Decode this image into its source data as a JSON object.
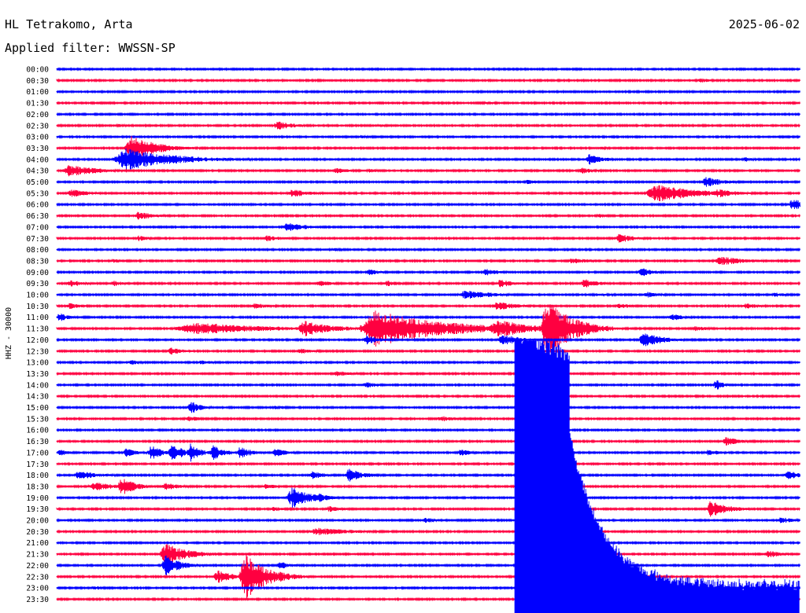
{
  "header": {
    "station": "HL Tetrakomo, Arta",
    "date": "2025-06-02",
    "filter": "Applied filter: WWSSN-SP"
  },
  "chart_data": {
    "type": "helicorder",
    "ylabel": "HHZ - 30000",
    "colors": [
      "#0000ff",
      "#ff0040"
    ],
    "rows": [
      "00:00",
      "00:30",
      "01:00",
      "01:30",
      "02:00",
      "02:30",
      "03:00",
      "03:30",
      "04:00",
      "04:30",
      "05:00",
      "05:30",
      "06:00",
      "06:30",
      "07:00",
      "07:30",
      "08:00",
      "08:30",
      "09:00",
      "09:30",
      "10:00",
      "10:30",
      "11:00",
      "11:30",
      "12:00",
      "12:30",
      "13:00",
      "13:30",
      "14:00",
      "14:30",
      "15:00",
      "15:30",
      "16:00",
      "16:30",
      "17:00",
      "17:30",
      "18:00",
      "18:30",
      "19:00",
      "19:30",
      "20:00",
      "20:30",
      "21:00",
      "21:30",
      "22:00",
      "22:30",
      "23:00",
      "23:30"
    ],
    "events": [
      {
        "row": 0,
        "minute": 7.7,
        "amp": 1.5,
        "dur": 0.3
      },
      {
        "row": 1,
        "minute": 26.0,
        "amp": 3,
        "dur": 0.5
      },
      {
        "row": 3,
        "minute": 17.3,
        "amp": 2,
        "dur": 0.4
      },
      {
        "row": 5,
        "minute": 2.5,
        "amp": 2,
        "dur": 0.5
      },
      {
        "row": 5,
        "minute": 8.9,
        "amp": 6,
        "dur": 0.7
      },
      {
        "row": 5,
        "minute": 13.0,
        "amp": 2,
        "dur": 0.4
      },
      {
        "row": 6,
        "minute": 12.3,
        "amp": 2,
        "dur": 0.4
      },
      {
        "row": 7,
        "minute": 3.0,
        "amp": 16,
        "dur": 1.0
      },
      {
        "row": 7,
        "minute": 3.8,
        "amp": 8,
        "dur": 1.0
      },
      {
        "row": 7,
        "minute": 22.0,
        "amp": 2,
        "dur": 0.4
      },
      {
        "row": 8,
        "minute": 2.8,
        "amp": 14,
        "dur": 2.0
      },
      {
        "row": 8,
        "minute": 21.5,
        "amp": 7,
        "dur": 0.6
      },
      {
        "row": 8,
        "minute": 27.8,
        "amp": 3,
        "dur": 0.5
      },
      {
        "row": 9,
        "minute": 0.5,
        "amp": 8,
        "dur": 1.2
      },
      {
        "row": 9,
        "minute": 11.3,
        "amp": 4,
        "dur": 0.6
      },
      {
        "row": 9,
        "minute": 12.6,
        "amp": 3,
        "dur": 0.5
      },
      {
        "row": 9,
        "minute": 21.2,
        "amp": 4,
        "dur": 0.5
      },
      {
        "row": 10,
        "minute": 19.0,
        "amp": 3,
        "dur": 0.5
      },
      {
        "row": 10,
        "minute": 26.2,
        "amp": 7,
        "dur": 0.7
      },
      {
        "row": 11,
        "minute": 0.6,
        "amp": 5,
        "dur": 0.8
      },
      {
        "row": 11,
        "minute": 9.5,
        "amp": 6,
        "dur": 0.7
      },
      {
        "row": 11,
        "minute": 24.2,
        "amp": 12,
        "dur": 1.6
      },
      {
        "row": 11,
        "minute": 26.7,
        "amp": 6,
        "dur": 0.8
      },
      {
        "row": 12,
        "minute": 29.7,
        "amp": 8,
        "dur": 0.6
      },
      {
        "row": 13,
        "minute": 3.3,
        "amp": 6,
        "dur": 0.6
      },
      {
        "row": 13,
        "minute": 21.9,
        "amp": 3,
        "dur": 0.4
      },
      {
        "row": 14,
        "minute": 9.3,
        "amp": 7,
        "dur": 0.7
      },
      {
        "row": 15,
        "minute": 3.3,
        "amp": 4,
        "dur": 0.5
      },
      {
        "row": 15,
        "minute": 8.5,
        "amp": 4,
        "dur": 0.7
      },
      {
        "row": 15,
        "minute": 22.7,
        "amp": 6,
        "dur": 0.7
      },
      {
        "row": 16,
        "minute": 11.2,
        "amp": 3,
        "dur": 0.4
      },
      {
        "row": 17,
        "minute": 2.3,
        "amp": 3,
        "dur": 0.5
      },
      {
        "row": 17,
        "minute": 20.8,
        "amp": 4,
        "dur": 0.8
      },
      {
        "row": 17,
        "minute": 26.8,
        "amp": 6,
        "dur": 1.0
      },
      {
        "row": 18,
        "minute": 12.6,
        "amp": 4,
        "dur": 0.5
      },
      {
        "row": 18,
        "minute": 17.3,
        "amp": 5,
        "dur": 0.6
      },
      {
        "row": 18,
        "minute": 23.6,
        "amp": 6,
        "dur": 0.5
      },
      {
        "row": 19,
        "minute": 0.5,
        "amp": 5,
        "dur": 0.6
      },
      {
        "row": 19,
        "minute": 2.3,
        "amp": 4,
        "dur": 0.5
      },
      {
        "row": 19,
        "minute": 10.6,
        "amp": 4,
        "dur": 0.6
      },
      {
        "row": 19,
        "minute": 13.3,
        "amp": 4,
        "dur": 0.6
      },
      {
        "row": 19,
        "minute": 17.9,
        "amp": 5,
        "dur": 0.7
      },
      {
        "row": 19,
        "minute": 21.3,
        "amp": 6,
        "dur": 0.6
      },
      {
        "row": 20,
        "minute": 16.5,
        "amp": 6,
        "dur": 1.2
      },
      {
        "row": 20,
        "minute": 21.8,
        "amp": 3,
        "dur": 0.6
      },
      {
        "row": 20,
        "minute": 23.8,
        "amp": 4,
        "dur": 0.6
      },
      {
        "row": 20,
        "minute": 29.0,
        "amp": 3,
        "dur": 0.5
      },
      {
        "row": 21,
        "minute": 0.5,
        "amp": 4,
        "dur": 0.6
      },
      {
        "row": 21,
        "minute": 8.0,
        "amp": 4,
        "dur": 0.6
      },
      {
        "row": 21,
        "minute": 17.8,
        "amp": 6,
        "dur": 0.8
      },
      {
        "row": 21,
        "minute": 22.7,
        "amp": 4,
        "dur": 0.5
      },
      {
        "row": 21,
        "minute": 27.8,
        "amp": 4,
        "dur": 0.6
      },
      {
        "row": 22,
        "minute": 0.1,
        "amp": 6,
        "dur": 0.4
      },
      {
        "row": 22,
        "minute": 24.8,
        "amp": 5,
        "dur": 0.6
      },
      {
        "row": 23,
        "minute": 5.5,
        "amp": 8,
        "dur": 3.0
      },
      {
        "row": 23,
        "minute": 10.0,
        "amp": 10,
        "dur": 1.2
      },
      {
        "row": 23,
        "minute": 12.9,
        "amp": 24,
        "dur": 2.6
      },
      {
        "row": 23,
        "minute": 17.8,
        "amp": 12,
        "dur": 1.4
      },
      {
        "row": 23,
        "minute": 19.8,
        "amp": 40,
        "dur": 1.0
      },
      {
        "row": 23,
        "minute": 25.8,
        "amp": 4,
        "dur": 0.5
      },
      {
        "row": 24,
        "minute": 12.5,
        "amp": 6,
        "dur": 0.6
      },
      {
        "row": 24,
        "minute": 18.0,
        "amp": 7,
        "dur": 0.9
      },
      {
        "row": 24,
        "minute": 23.7,
        "amp": 10,
        "dur": 0.8
      },
      {
        "row": 25,
        "minute": 4.6,
        "amp": 5,
        "dur": 0.6
      },
      {
        "row": 25,
        "minute": 9.8,
        "amp": 4,
        "dur": 0.6
      },
      {
        "row": 26,
        "minute": 3.0,
        "amp": 3,
        "dur": 0.6
      },
      {
        "row": 26,
        "minute": 5.8,
        "amp": 3,
        "dur": 0.6
      },
      {
        "row": 27,
        "minute": 11.3,
        "amp": 4,
        "dur": 0.6
      },
      {
        "row": 28,
        "minute": 12.5,
        "amp": 4,
        "dur": 0.5
      },
      {
        "row": 28,
        "minute": 26.6,
        "amp": 8,
        "dur": 0.3
      },
      {
        "row": 30,
        "minute": 5.4,
        "amp": 9,
        "dur": 0.4
      },
      {
        "row": 30,
        "minute": 8.8,
        "amp": 3,
        "dur": 0.5
      },
      {
        "row": 31,
        "minute": 5.3,
        "amp": 4,
        "dur": 0.5
      },
      {
        "row": 31,
        "minute": 15.5,
        "amp": 4,
        "dur": 0.6
      },
      {
        "row": 33,
        "minute": 27.0,
        "amp": 6,
        "dur": 0.6
      },
      {
        "row": 34,
        "minute": 0.1,
        "amp": 5,
        "dur": 0.4
      },
      {
        "row": 34,
        "minute": 2.8,
        "amp": 6,
        "dur": 0.5
      },
      {
        "row": 34,
        "minute": 3.8,
        "amp": 10,
        "dur": 0.5
      },
      {
        "row": 34,
        "minute": 4.6,
        "amp": 14,
        "dur": 0.5
      },
      {
        "row": 34,
        "minute": 5.4,
        "amp": 12,
        "dur": 0.4
      },
      {
        "row": 34,
        "minute": 6.3,
        "amp": 10,
        "dur": 0.5
      },
      {
        "row": 34,
        "minute": 7.4,
        "amp": 8,
        "dur": 0.5
      },
      {
        "row": 34,
        "minute": 8.8,
        "amp": 6,
        "dur": 0.5
      },
      {
        "row": 34,
        "minute": 16.3,
        "amp": 4,
        "dur": 0.8
      },
      {
        "row": 34,
        "minute": 19.6,
        "amp": 4,
        "dur": 0.6
      },
      {
        "row": 34,
        "minute": 26.3,
        "amp": 4,
        "dur": 0.6
      },
      {
        "row": 36,
        "minute": 0.9,
        "amp": 6,
        "dur": 0.8
      },
      {
        "row": 36,
        "minute": 10.3,
        "amp": 6,
        "dur": 0.5
      },
      {
        "row": 36,
        "minute": 11.8,
        "amp": 9,
        "dur": 0.6
      },
      {
        "row": 36,
        "minute": 29.5,
        "amp": 6,
        "dur": 0.6
      },
      {
        "row": 37,
        "minute": 1.5,
        "amp": 6,
        "dur": 1.0
      },
      {
        "row": 37,
        "minute": 2.6,
        "amp": 12,
        "dur": 0.6
      },
      {
        "row": 37,
        "minute": 4.4,
        "amp": 5,
        "dur": 0.6
      },
      {
        "row": 37,
        "minute": 8.4,
        "amp": 4,
        "dur": 0.5
      },
      {
        "row": 38,
        "minute": 9.5,
        "amp": 14,
        "dur": 0.8
      },
      {
        "row": 38,
        "minute": 10.6,
        "amp": 6,
        "dur": 0.5
      },
      {
        "row": 39,
        "minute": 8.7,
        "amp": 3,
        "dur": 0.5
      },
      {
        "row": 39,
        "minute": 11.0,
        "amp": 4,
        "dur": 0.6
      },
      {
        "row": 39,
        "minute": 26.4,
        "amp": 12,
        "dur": 0.7
      },
      {
        "row": 40,
        "minute": 14.9,
        "amp": 4,
        "dur": 0.4
      },
      {
        "row": 40,
        "minute": 29.2,
        "amp": 5,
        "dur": 0.5
      },
      {
        "row": 41,
        "minute": 10.5,
        "amp": 5,
        "dur": 1.6
      },
      {
        "row": 43,
        "minute": 4.4,
        "amp": 14,
        "dur": 0.9
      },
      {
        "row": 43,
        "minute": 28.7,
        "amp": 6,
        "dur": 0.5
      },
      {
        "row": 44,
        "minute": 4.4,
        "amp": 14,
        "dur": 0.6
      },
      {
        "row": 44,
        "minute": 9.0,
        "amp": 5,
        "dur": 0.5
      },
      {
        "row": 45,
        "minute": 6.5,
        "amp": 8,
        "dur": 0.8
      },
      {
        "row": 45,
        "minute": 7.6,
        "amp": 30,
        "dur": 0.9
      },
      {
        "row": 46,
        "minute": 1.5,
        "amp": 3,
        "dur": 0.4
      }
    ],
    "mainshock": {
      "row": 45,
      "minute": 18.5,
      "amp": 330
    }
  }
}
